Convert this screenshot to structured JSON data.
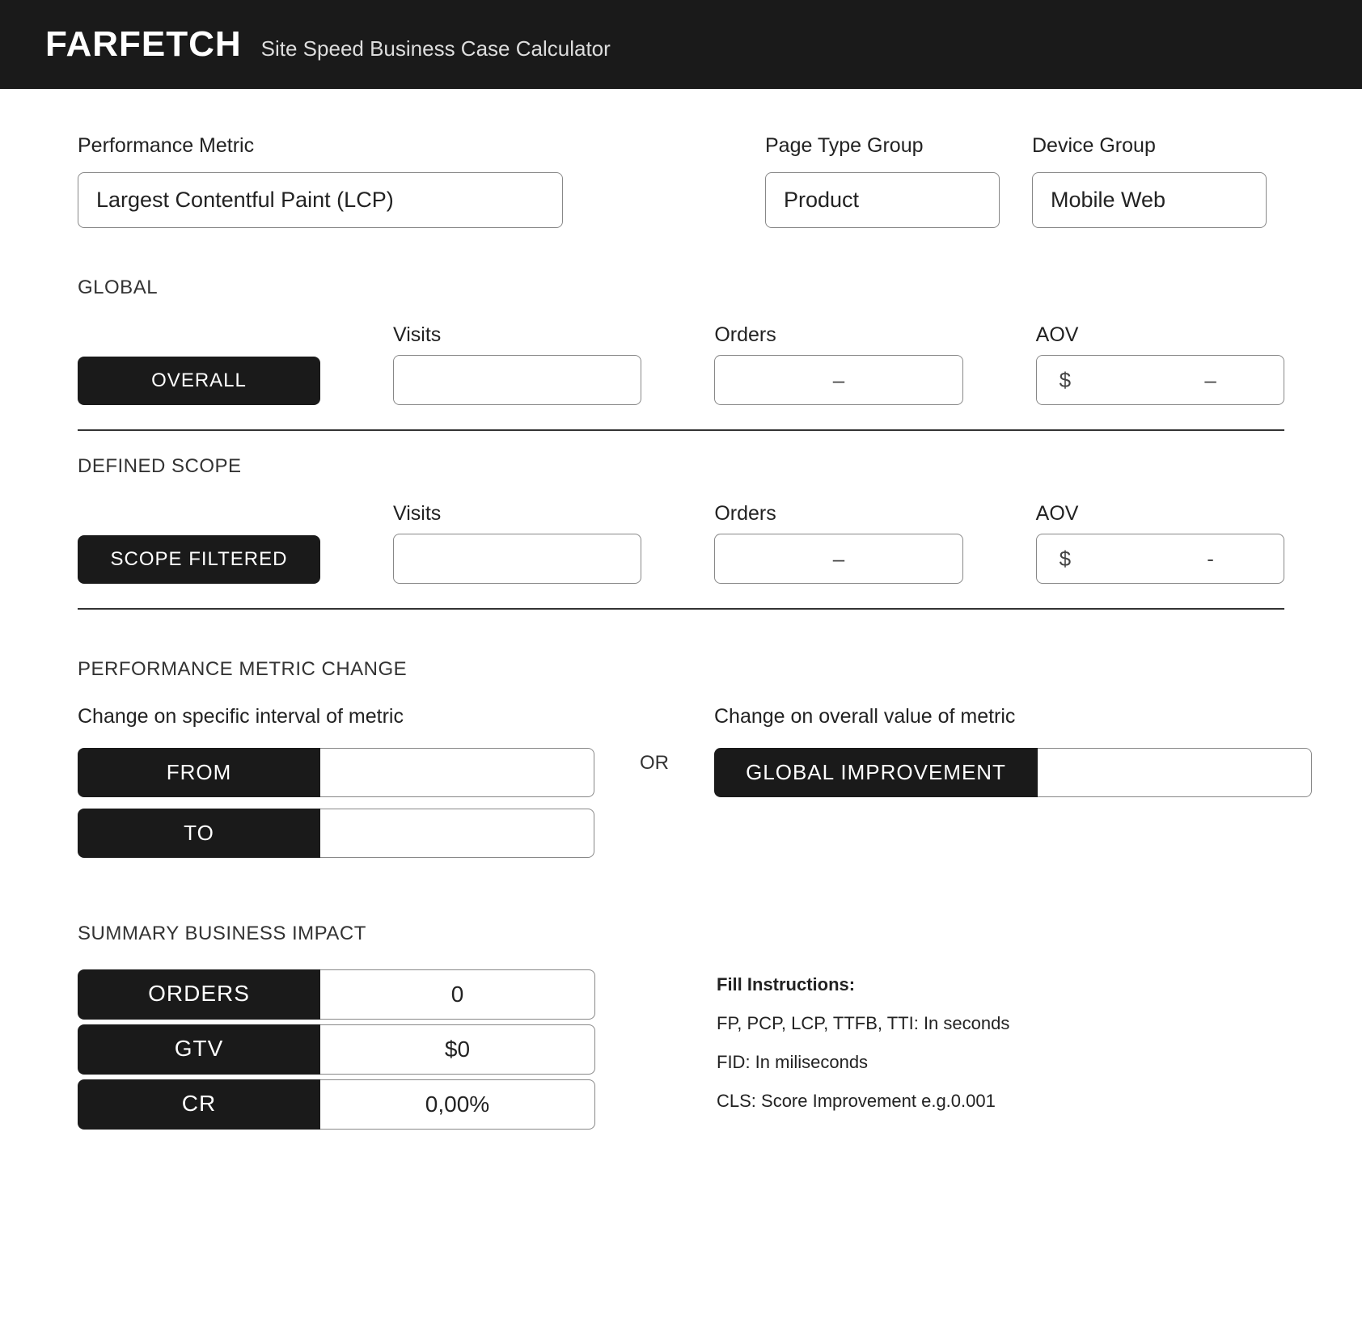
{
  "header": {
    "brand": "FARFETCH",
    "subtitle": "Site Speed Business Case Calculator"
  },
  "filters": {
    "metric": {
      "label": "Performance Metric",
      "value": "Largest Contentful Paint (LCP)"
    },
    "page_type": {
      "label": "Page Type Group",
      "value": "Product"
    },
    "device": {
      "label": "Device Group",
      "value": "Mobile Web"
    }
  },
  "global": {
    "section": "GLOBAL",
    "headers": {
      "visits": "Visits",
      "orders": "Orders",
      "aov": "AOV"
    },
    "row_label": "OVERALL",
    "visits": "",
    "orders": "–",
    "aov_symbol": "$",
    "aov_value": "–"
  },
  "scope": {
    "section": "DEFINED SCOPE",
    "headers": {
      "visits": "Visits",
      "orders": "Orders",
      "aov": "AOV"
    },
    "row_label": "SCOPE FILTERED",
    "visits": "",
    "orders": "–",
    "aov_symbol": "$",
    "aov_value": "-"
  },
  "change": {
    "section": "PERFORMANCE METRIC CHANGE",
    "interval_label": "Change on specific interval of metric",
    "from_label": "FROM",
    "to_label": "TO",
    "from_value": "",
    "to_value": "",
    "or": "OR",
    "overall_label": "Change on overall value of metric",
    "global_improvement_label": "GLOBAL IMPROVEMENT",
    "global_improvement_value": ""
  },
  "summary": {
    "section": "SUMMARY BUSINESS IMPACT",
    "rows": {
      "orders": {
        "label": "ORDERS",
        "value": "0"
      },
      "gtv": {
        "label": "GTV",
        "value": "$0"
      },
      "cr": {
        "label": "CR",
        "value": "0,00%"
      }
    },
    "instructions": {
      "title": "Fill Instructions:",
      "line1": "FP, PCP, LCP, TTFB, TTI: In seconds",
      "line2": "FID: In miliseconds",
      "line3": "CLS: Score Improvement e.g.0.001"
    }
  }
}
